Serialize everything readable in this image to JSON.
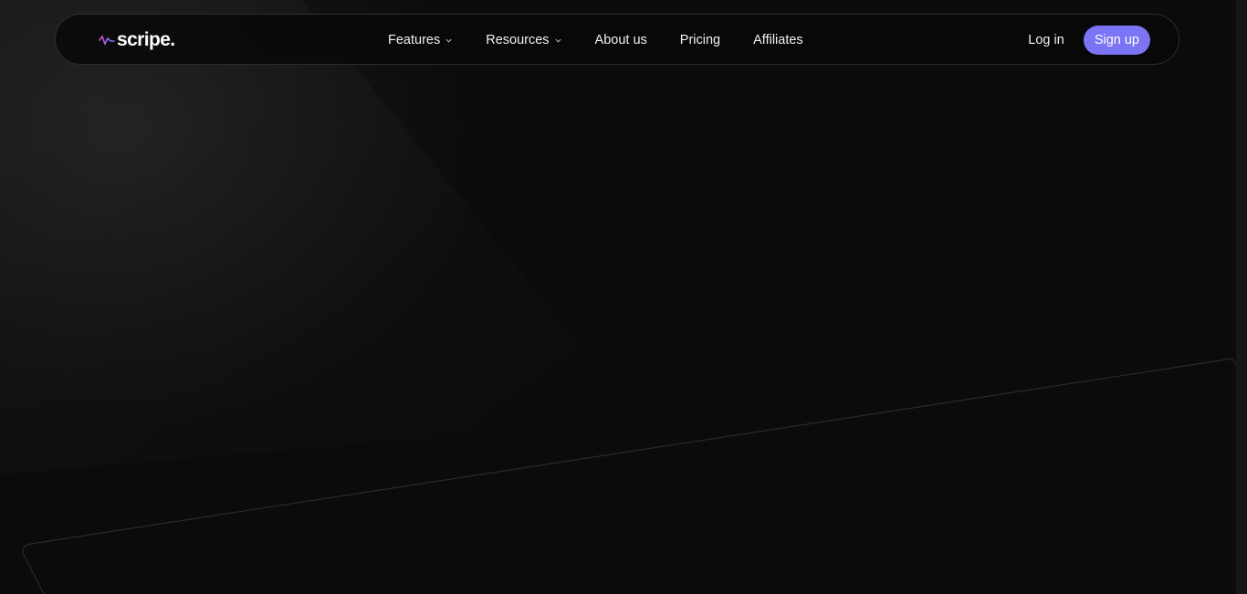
{
  "brand": {
    "name": "scripe.",
    "logo_icon": "waveform-icon",
    "accent_colors": [
      "#e24bd8",
      "#8b6cf6",
      "#5b7cfa"
    ]
  },
  "nav": {
    "items": [
      {
        "label": "Features",
        "has_dropdown": true,
        "icon": "chevron-down-icon"
      },
      {
        "label": "Resources",
        "has_dropdown": true,
        "icon": "chevron-down-icon"
      },
      {
        "label": "About us",
        "has_dropdown": false
      },
      {
        "label": "Pricing",
        "has_dropdown": false
      },
      {
        "label": "Affiliates",
        "has_dropdown": false
      }
    ]
  },
  "auth": {
    "login_label": "Log in",
    "signup_label": "Sign up",
    "signup_color": "#7b74f5"
  },
  "theme": {
    "background": "#0b0b0b",
    "text": "#f2f2f2"
  }
}
